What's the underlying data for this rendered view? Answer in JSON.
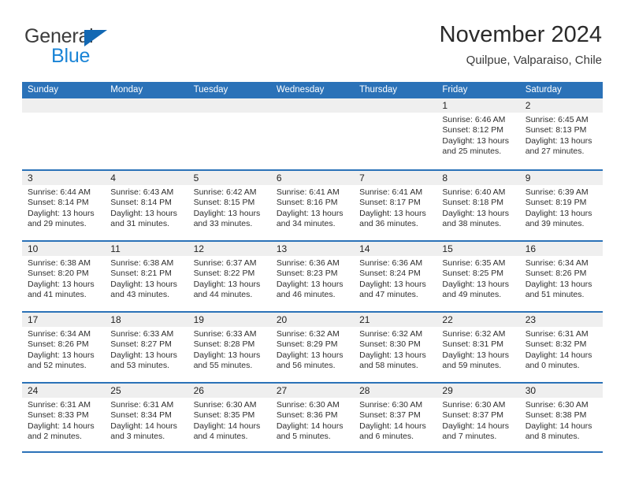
{
  "logo": {
    "primary_text": "General",
    "secondary_text": "Blue",
    "primary_color": "#3c3c3c",
    "secondary_color": "#1a84d6",
    "triangle_color": "#1268b3"
  },
  "header": {
    "title": "November 2024",
    "subtitle": "Quilpue, Valparaiso, Chile"
  },
  "theme": {
    "header_row_color": "#2b72b8",
    "daynum_band_color": "#efefef",
    "grid_line_color": "#2b72b8",
    "text_color": "#2e2e2e"
  },
  "weekdays": [
    "Sunday",
    "Monday",
    "Tuesday",
    "Wednesday",
    "Thursday",
    "Friday",
    "Saturday"
  ],
  "labels": {
    "sunrise_prefix": "Sunrise:",
    "sunset_prefix": "Sunset:",
    "daylight_prefix": "Daylight:"
  },
  "weeks": [
    [
      {
        "day": "",
        "empty": true
      },
      {
        "day": "",
        "empty": true
      },
      {
        "day": "",
        "empty": true
      },
      {
        "day": "",
        "empty": true
      },
      {
        "day": "",
        "empty": true
      },
      {
        "day": "1",
        "sunrise": "Sunrise: 6:46 AM",
        "sunset": "Sunset: 8:12 PM",
        "daylight_line1": "Daylight: 13 hours",
        "daylight_line2": "and 25 minutes."
      },
      {
        "day": "2",
        "sunrise": "Sunrise: 6:45 AM",
        "sunset": "Sunset: 8:13 PM",
        "daylight_line1": "Daylight: 13 hours",
        "daylight_line2": "and 27 minutes."
      }
    ],
    [
      {
        "day": "3",
        "sunrise": "Sunrise: 6:44 AM",
        "sunset": "Sunset: 8:14 PM",
        "daylight_line1": "Daylight: 13 hours",
        "daylight_line2": "and 29 minutes."
      },
      {
        "day": "4",
        "sunrise": "Sunrise: 6:43 AM",
        "sunset": "Sunset: 8:14 PM",
        "daylight_line1": "Daylight: 13 hours",
        "daylight_line2": "and 31 minutes."
      },
      {
        "day": "5",
        "sunrise": "Sunrise: 6:42 AM",
        "sunset": "Sunset: 8:15 PM",
        "daylight_line1": "Daylight: 13 hours",
        "daylight_line2": "and 33 minutes."
      },
      {
        "day": "6",
        "sunrise": "Sunrise: 6:41 AM",
        "sunset": "Sunset: 8:16 PM",
        "daylight_line1": "Daylight: 13 hours",
        "daylight_line2": "and 34 minutes."
      },
      {
        "day": "7",
        "sunrise": "Sunrise: 6:41 AM",
        "sunset": "Sunset: 8:17 PM",
        "daylight_line1": "Daylight: 13 hours",
        "daylight_line2": "and 36 minutes."
      },
      {
        "day": "8",
        "sunrise": "Sunrise: 6:40 AM",
        "sunset": "Sunset: 8:18 PM",
        "daylight_line1": "Daylight: 13 hours",
        "daylight_line2": "and 38 minutes."
      },
      {
        "day": "9",
        "sunrise": "Sunrise: 6:39 AM",
        "sunset": "Sunset: 8:19 PM",
        "daylight_line1": "Daylight: 13 hours",
        "daylight_line2": "and 39 minutes."
      }
    ],
    [
      {
        "day": "10",
        "sunrise": "Sunrise: 6:38 AM",
        "sunset": "Sunset: 8:20 PM",
        "daylight_line1": "Daylight: 13 hours",
        "daylight_line2": "and 41 minutes."
      },
      {
        "day": "11",
        "sunrise": "Sunrise: 6:38 AM",
        "sunset": "Sunset: 8:21 PM",
        "daylight_line1": "Daylight: 13 hours",
        "daylight_line2": "and 43 minutes."
      },
      {
        "day": "12",
        "sunrise": "Sunrise: 6:37 AM",
        "sunset": "Sunset: 8:22 PM",
        "daylight_line1": "Daylight: 13 hours",
        "daylight_line2": "and 44 minutes."
      },
      {
        "day": "13",
        "sunrise": "Sunrise: 6:36 AM",
        "sunset": "Sunset: 8:23 PM",
        "daylight_line1": "Daylight: 13 hours",
        "daylight_line2": "and 46 minutes."
      },
      {
        "day": "14",
        "sunrise": "Sunrise: 6:36 AM",
        "sunset": "Sunset: 8:24 PM",
        "daylight_line1": "Daylight: 13 hours",
        "daylight_line2": "and 47 minutes."
      },
      {
        "day": "15",
        "sunrise": "Sunrise: 6:35 AM",
        "sunset": "Sunset: 8:25 PM",
        "daylight_line1": "Daylight: 13 hours",
        "daylight_line2": "and 49 minutes."
      },
      {
        "day": "16",
        "sunrise": "Sunrise: 6:34 AM",
        "sunset": "Sunset: 8:26 PM",
        "daylight_line1": "Daylight: 13 hours",
        "daylight_line2": "and 51 minutes."
      }
    ],
    [
      {
        "day": "17",
        "sunrise": "Sunrise: 6:34 AM",
        "sunset": "Sunset: 8:26 PM",
        "daylight_line1": "Daylight: 13 hours",
        "daylight_line2": "and 52 minutes."
      },
      {
        "day": "18",
        "sunrise": "Sunrise: 6:33 AM",
        "sunset": "Sunset: 8:27 PM",
        "daylight_line1": "Daylight: 13 hours",
        "daylight_line2": "and 53 minutes."
      },
      {
        "day": "19",
        "sunrise": "Sunrise: 6:33 AM",
        "sunset": "Sunset: 8:28 PM",
        "daylight_line1": "Daylight: 13 hours",
        "daylight_line2": "and 55 minutes."
      },
      {
        "day": "20",
        "sunrise": "Sunrise: 6:32 AM",
        "sunset": "Sunset: 8:29 PM",
        "daylight_line1": "Daylight: 13 hours",
        "daylight_line2": "and 56 minutes."
      },
      {
        "day": "21",
        "sunrise": "Sunrise: 6:32 AM",
        "sunset": "Sunset: 8:30 PM",
        "daylight_line1": "Daylight: 13 hours",
        "daylight_line2": "and 58 minutes."
      },
      {
        "day": "22",
        "sunrise": "Sunrise: 6:32 AM",
        "sunset": "Sunset: 8:31 PM",
        "daylight_line1": "Daylight: 13 hours",
        "daylight_line2": "and 59 minutes."
      },
      {
        "day": "23",
        "sunrise": "Sunrise: 6:31 AM",
        "sunset": "Sunset: 8:32 PM",
        "daylight_line1": "Daylight: 14 hours",
        "daylight_line2": "and 0 minutes."
      }
    ],
    [
      {
        "day": "24",
        "sunrise": "Sunrise: 6:31 AM",
        "sunset": "Sunset: 8:33 PM",
        "daylight_line1": "Daylight: 14 hours",
        "daylight_line2": "and 2 minutes."
      },
      {
        "day": "25",
        "sunrise": "Sunrise: 6:31 AM",
        "sunset": "Sunset: 8:34 PM",
        "daylight_line1": "Daylight: 14 hours",
        "daylight_line2": "and 3 minutes."
      },
      {
        "day": "26",
        "sunrise": "Sunrise: 6:30 AM",
        "sunset": "Sunset: 8:35 PM",
        "daylight_line1": "Daylight: 14 hours",
        "daylight_line2": "and 4 minutes."
      },
      {
        "day": "27",
        "sunrise": "Sunrise: 6:30 AM",
        "sunset": "Sunset: 8:36 PM",
        "daylight_line1": "Daylight: 14 hours",
        "daylight_line2": "and 5 minutes."
      },
      {
        "day": "28",
        "sunrise": "Sunrise: 6:30 AM",
        "sunset": "Sunset: 8:37 PM",
        "daylight_line1": "Daylight: 14 hours",
        "daylight_line2": "and 6 minutes."
      },
      {
        "day": "29",
        "sunrise": "Sunrise: 6:30 AM",
        "sunset": "Sunset: 8:37 PM",
        "daylight_line1": "Daylight: 14 hours",
        "daylight_line2": "and 7 minutes."
      },
      {
        "day": "30",
        "sunrise": "Sunrise: 6:30 AM",
        "sunset": "Sunset: 8:38 PM",
        "daylight_line1": "Daylight: 14 hours",
        "daylight_line2": "and 8 minutes."
      }
    ]
  ]
}
